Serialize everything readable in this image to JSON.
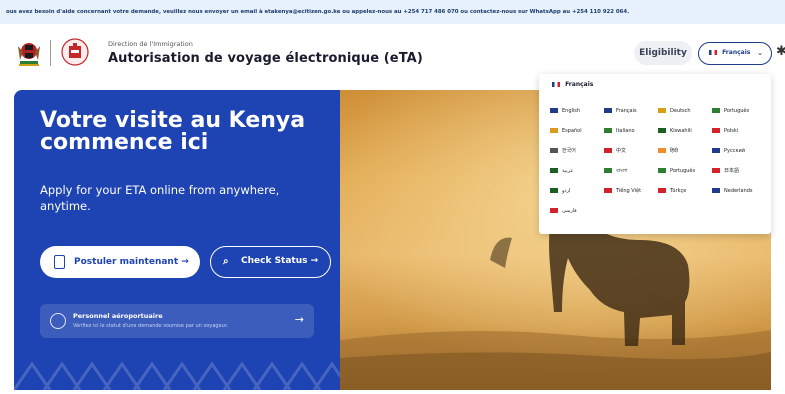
{
  "notice_bar": {
    "text": "ous avez besoin d'aide concernant votre demande, veuillez nous envoyer un email à etakenya@ecitizen.go.ke ou appelez-nous au +254 717 486 070 ou contactez-nous sur WhatsApp au +254 110 922 064."
  },
  "header": {
    "subtitle": "Direction de l'Immigration",
    "title": "Autorisation de voyage électronique (eTA)",
    "eligibility_label": "Eligibility",
    "language_label": "Français"
  },
  "hero": {
    "title": "Votre visite au Kenya commence ici",
    "subtitle": "Apply for your ETA online from anywhere, anytime.",
    "apply_label": "Postuler maintenant →",
    "check_label": "Check Status →",
    "airport_title": "Personnel aéroportuaire",
    "airport_sub": "Vérifiez ici le statut d'une demande soumise par un voyageur."
  },
  "language_menu": {
    "selected": "Français",
    "items": [
      {
        "label": "English",
        "color": "#1f3b8a"
      },
      {
        "label": "Français",
        "color": "#1f3b8a"
      },
      {
        "label": "Deutsch",
        "color": "#d4a017"
      },
      {
        "label": "Português",
        "color": "#2e7d32"
      },
      {
        "label": "Español",
        "color": "#d99a1e"
      },
      {
        "label": "Italiano",
        "color": "#2e7d32"
      },
      {
        "label": "Kiswahili",
        "color": "#1b5e20"
      },
      {
        "label": "Polski",
        "color": "#d3222a"
      },
      {
        "label": "한국어",
        "color": "#555555"
      },
      {
        "label": "中文",
        "color": "#d3222a"
      },
      {
        "label": "हिंदी",
        "color": "#f28c28"
      },
      {
        "label": "Русский",
        "color": "#1f3b8a"
      },
      {
        "label": "عربية",
        "color": "#1b5e20"
      },
      {
        "label": "বাংলা",
        "color": "#2e7d32"
      },
      {
        "label": "Português",
        "color": "#2e7d32"
      },
      {
        "label": "日本語",
        "color": "#d3222a"
      },
      {
        "label": "اردو",
        "color": "#1b5e20"
      },
      {
        "label": "Tiếng Việt",
        "color": "#d3222a"
      },
      {
        "label": "Türkçe",
        "color": "#d3222a"
      },
      {
        "label": "Nederlands",
        "color": "#1f3b8a"
      },
      {
        "label": "فارسی",
        "color": "#d3222a"
      }
    ]
  }
}
